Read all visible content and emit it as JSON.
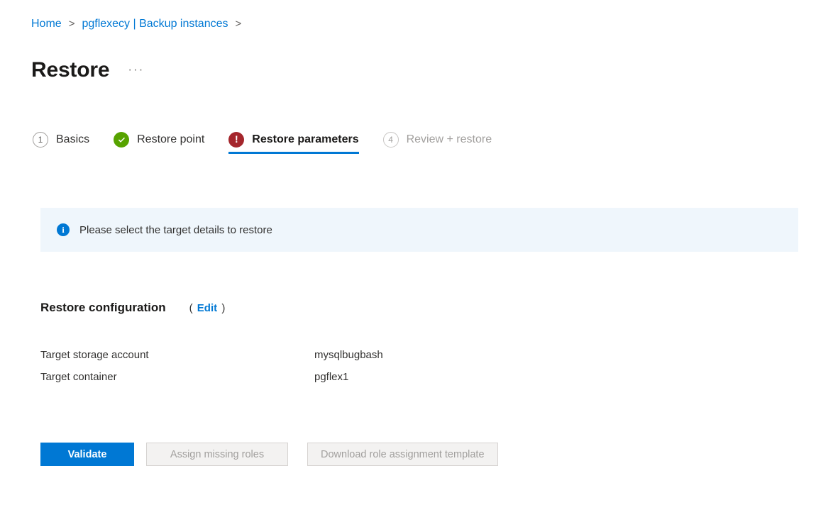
{
  "breadcrumb": {
    "items": [
      {
        "label": "Home"
      },
      {
        "label": "pgflexecy | Backup instances"
      }
    ],
    "separator": ">"
  },
  "header": {
    "title": "Restore",
    "more_menu": "···"
  },
  "wizard": {
    "tabs": [
      {
        "label": "Basics",
        "badge": "1",
        "state": "pending"
      },
      {
        "label": "Restore point",
        "badge": "check-icon",
        "state": "complete"
      },
      {
        "label": "Restore parameters",
        "badge": "error-icon",
        "state": "active-error"
      },
      {
        "label": "Review + restore",
        "badge": "4",
        "state": "disabled"
      }
    ]
  },
  "info_banner": {
    "icon": "info-icon",
    "message": "Please select the target details to restore",
    "background": "#eff6fc",
    "icon_color": "#0078d4"
  },
  "restore_configuration": {
    "title": "Restore configuration",
    "edit_prefix": "(",
    "edit_label": "Edit",
    "edit_suffix": ")",
    "rows": [
      {
        "key": "Target storage account",
        "value": "mysqlbugbash"
      },
      {
        "key": "Target container",
        "value": "pgflex1"
      }
    ]
  },
  "actions": {
    "validate": {
      "label": "Validate",
      "enabled": true
    },
    "assign_roles": {
      "label": "Assign missing roles",
      "enabled": false
    },
    "download_template": {
      "label": "Download role assignment template",
      "enabled": false
    }
  },
  "colors": {
    "accent": "#0078d4",
    "success": "#57a300",
    "error": "#a4262c",
    "disabled_text": "#a19f9d"
  }
}
